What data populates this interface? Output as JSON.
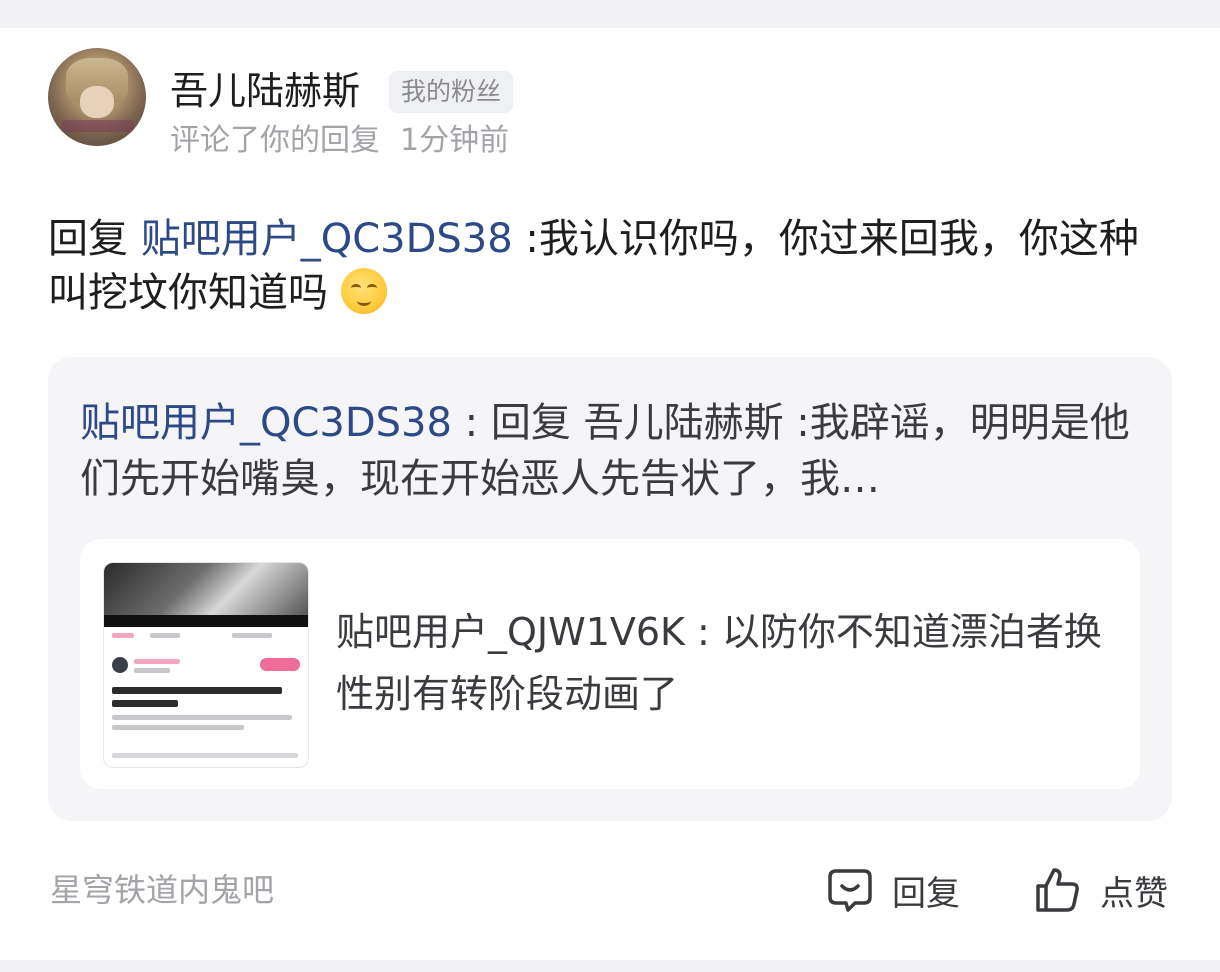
{
  "user": {
    "name": "吾儿陆赫斯",
    "badge": "我的粉丝",
    "action_text": "评论了你的回复",
    "time": "1分钟前"
  },
  "reply": {
    "prefix": "回复",
    "mention": "贴吧用户_QC3DS38",
    "text": " :我认识你吗，你过来回我，你这种叫挖坟你知道吗",
    "emoji_icon": "smiling-face-emoji"
  },
  "quoted": {
    "author": "贴吧用户_QC3DS38",
    "text": " : 回复 吾儿陆赫斯 :我辟谣，明明是他们先开始嘴臭，现在开始恶人先告状了，我…",
    "inner_post": {
      "text": "贴吧用户_QJW1V6K : 以防你不知道漂泊者换性别有转阶段动画了"
    }
  },
  "footer": {
    "forum_name": "星穹铁道内鬼吧",
    "reply_label": "回复",
    "like_label": "点赞"
  },
  "colors": {
    "mention": "#2d4a86",
    "secondary_text": "#a3a3a8",
    "card_bg": "#f5f5f8"
  }
}
